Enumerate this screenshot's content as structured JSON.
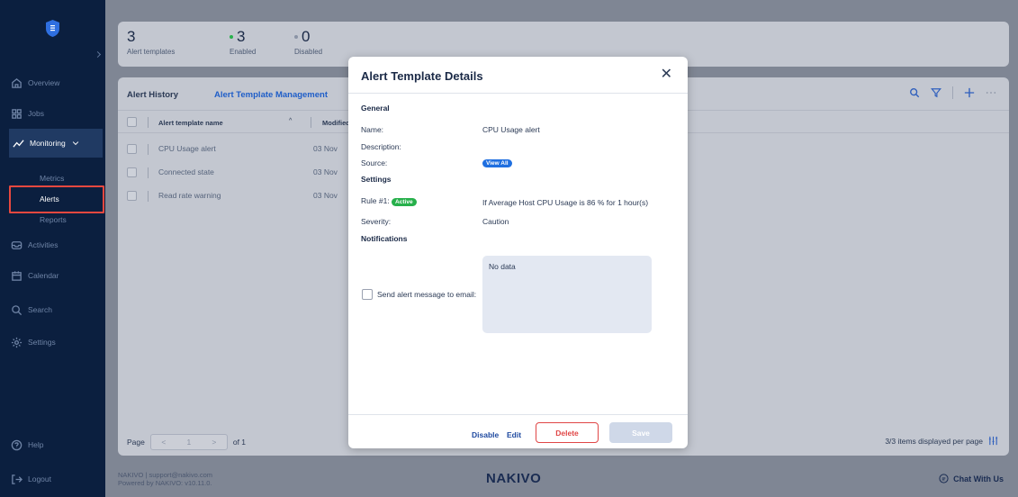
{
  "sidebar": {
    "nav": {
      "overview": "Overview",
      "jobs": "Jobs",
      "monitoring": "Monitoring",
      "activities": "Activities",
      "calendar": "Calendar",
      "search": "Search",
      "settings": "Settings",
      "help": "Help",
      "logout": "Logout"
    },
    "sub": {
      "metrics": "Metrics",
      "alerts": "Alerts",
      "reports": "Reports"
    }
  },
  "stats": {
    "total": {
      "value": "3",
      "label": "Alert templates"
    },
    "enabled": {
      "value": "3",
      "label": "Enabled",
      "color": "#27b04b"
    },
    "disabled": {
      "value": "0",
      "label": "Disabled",
      "color": "#8a93a5"
    }
  },
  "tabs": {
    "history": "Alert History",
    "management": "Alert Template Management"
  },
  "table": {
    "col_name": "Alert template name",
    "col_modified": "Modified",
    "rows": [
      {
        "name": "CPU Usage alert",
        "modified": "03 Nov"
      },
      {
        "name": "Connected state",
        "modified": "03 Nov"
      },
      {
        "name": "Read rate warning",
        "modified": "03 Nov"
      }
    ]
  },
  "pager": {
    "page_label": "Page",
    "current": "1",
    "of": "of 1"
  },
  "items_per_page": "3/3 items displayed per page",
  "footer": {
    "line1": "NAKIVO | support@nakivo.com",
    "line2": "Powered by NAKIVO: v10.11.0.",
    "brand": "NAKIVO",
    "chat": "Chat With Us"
  },
  "modal": {
    "title": "Alert Template Details",
    "general": "General",
    "name_label": "Name:",
    "name_value": "CPU Usage alert",
    "description_label": "Description:",
    "source_label": "Source:",
    "source_pill": "View All",
    "settings": "Settings",
    "rule_label": "Rule #1:",
    "rule_status": "Active",
    "rule_value": "If Average Host CPU Usage is 86 % for 1 hour(s)",
    "severity_label": "Severity:",
    "severity_value": "Caution",
    "notifications": "Notifications",
    "email_label": "Send alert message to email:",
    "no_data": "No data",
    "disable": "Disable",
    "edit": "Edit",
    "delete": "Delete",
    "save": "Save"
  }
}
